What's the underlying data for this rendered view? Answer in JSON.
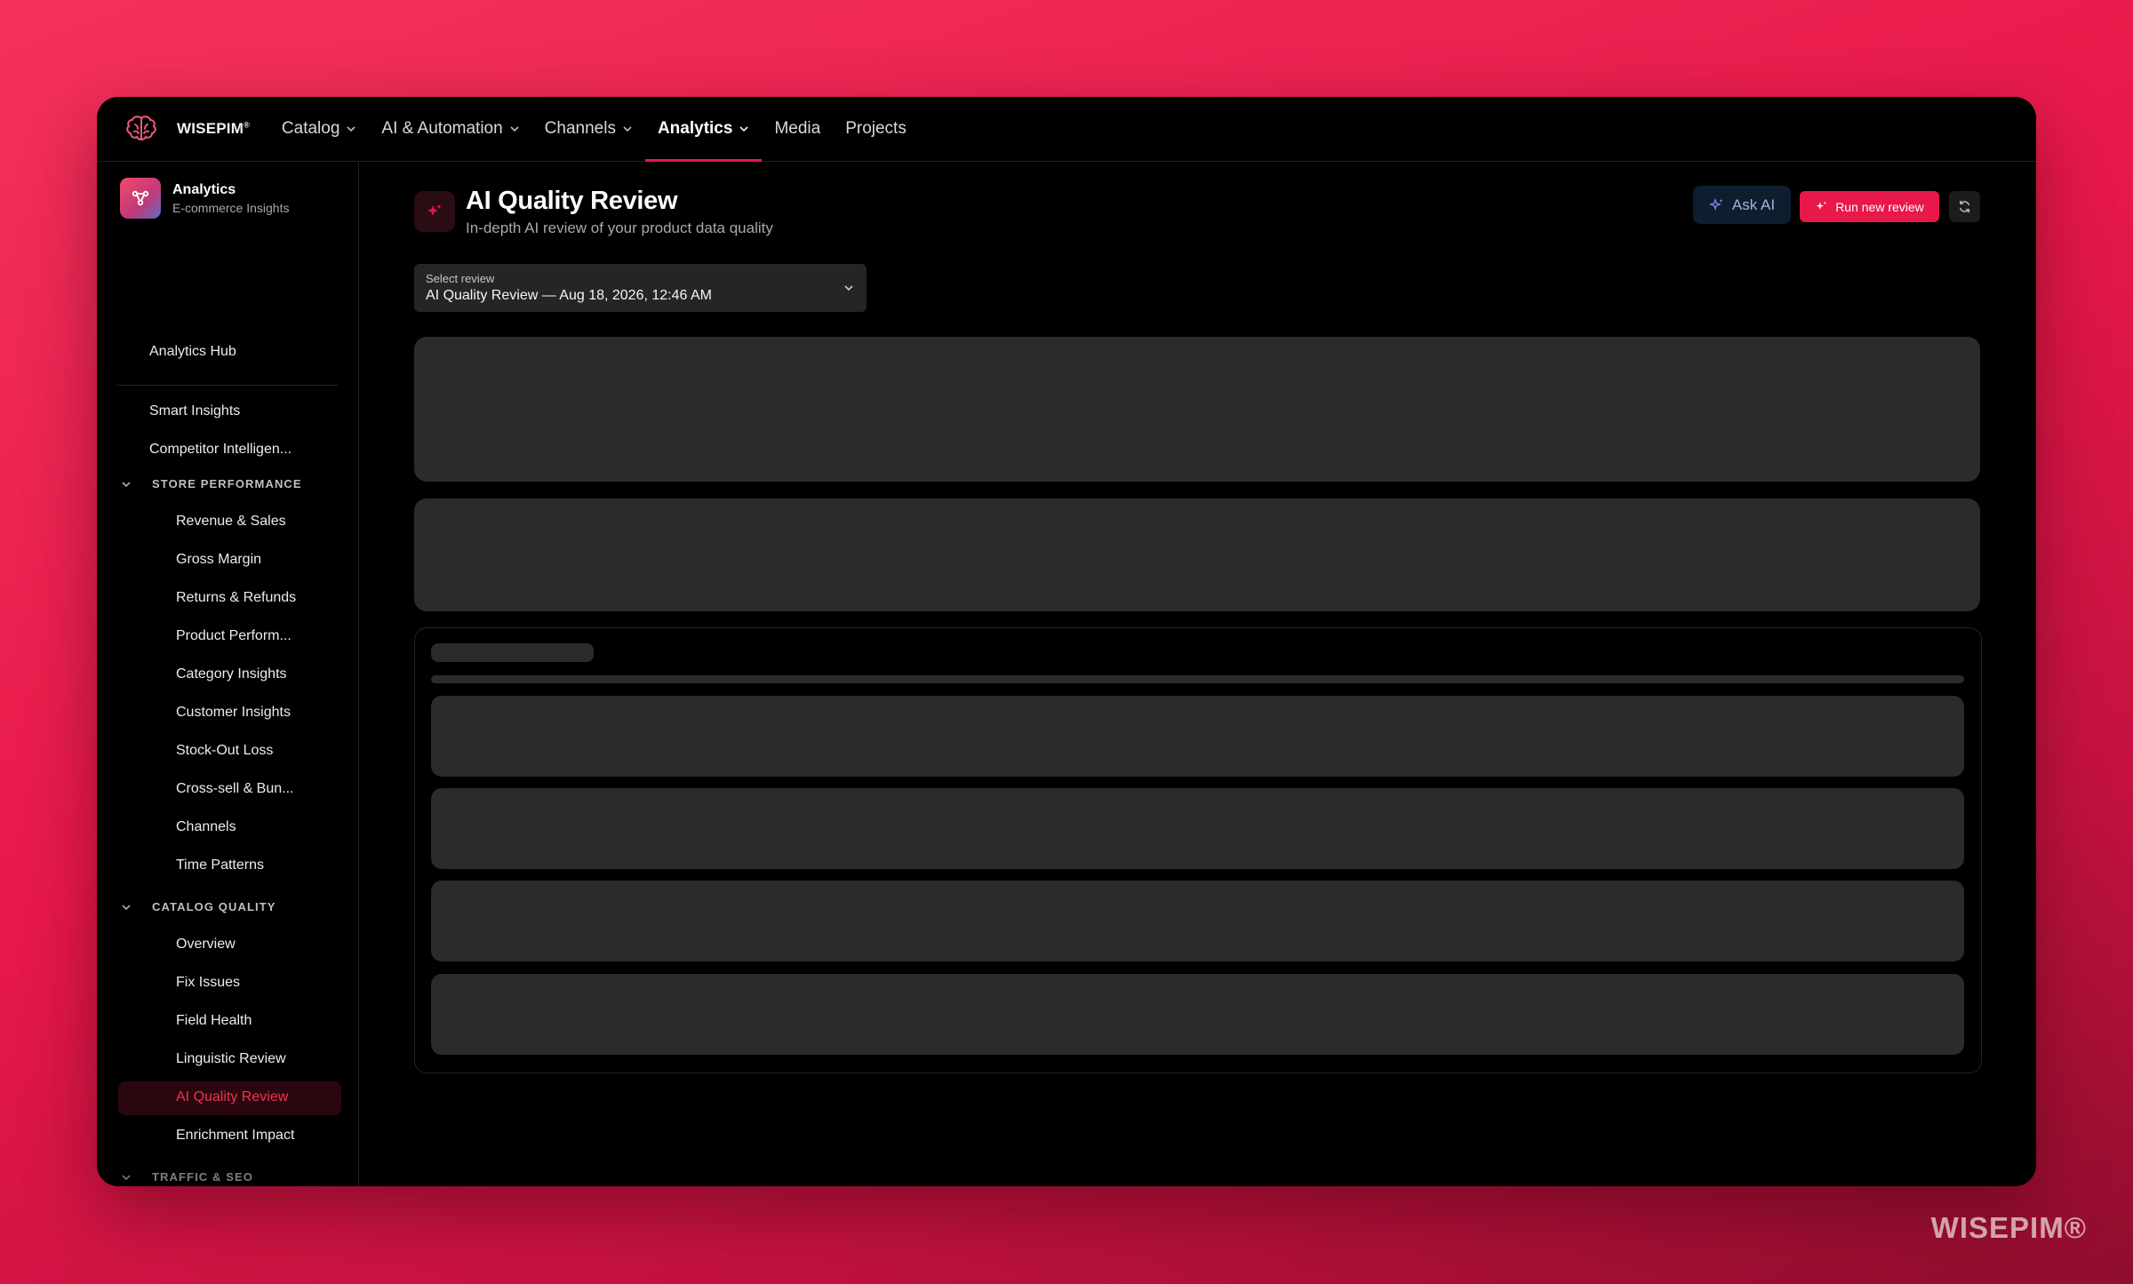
{
  "brand": {
    "name": "WISEPIM",
    "mark": "®"
  },
  "nav": {
    "items": [
      {
        "label": "Catalog",
        "dropdown": true
      },
      {
        "label": "AI & Automation",
        "dropdown": true
      },
      {
        "label": "Channels",
        "dropdown": true
      },
      {
        "label": "Analytics",
        "dropdown": true,
        "active": true
      },
      {
        "label": "Media",
        "dropdown": false
      },
      {
        "label": "Projects",
        "dropdown": false
      }
    ]
  },
  "sidebar": {
    "title": "Analytics",
    "subtitle": "E-commerce Insights",
    "hub": "Analytics Hub",
    "top_links": [
      "Smart Insights",
      "Competitor Intelligen..."
    ],
    "sections": [
      {
        "label": "STORE PERFORMANCE",
        "items": [
          "Revenue & Sales",
          "Gross Margin",
          "Returns & Refunds",
          "Product Perform...",
          "Category Insights",
          "Customer Insights",
          "Stock-Out Loss",
          "Cross-sell & Bun...",
          "Channels",
          "Time Patterns"
        ]
      },
      {
        "label": "CATALOG QUALITY",
        "items": [
          "Overview",
          "Fix Issues",
          "Field Health",
          "Linguistic Review",
          "AI Quality Review",
          "Enrichment Impact"
        ]
      },
      {
        "label": "TRAFFIC & SEO",
        "items": []
      }
    ],
    "active_item": "AI Quality Review"
  },
  "main": {
    "title": "AI Quality Review",
    "subtitle": "In-depth AI review of your product data quality",
    "ask_ai": "Ask AI",
    "run_review": "Run new review",
    "select": {
      "label": "Select review",
      "value": "AI Quality Review — Aug 18, 2026, 12:46 AM"
    }
  },
  "watermark": "WISEPIM®",
  "colors": {
    "accent": "#e8184a",
    "background": "#000000",
    "skeleton": "#2b2b2b"
  }
}
